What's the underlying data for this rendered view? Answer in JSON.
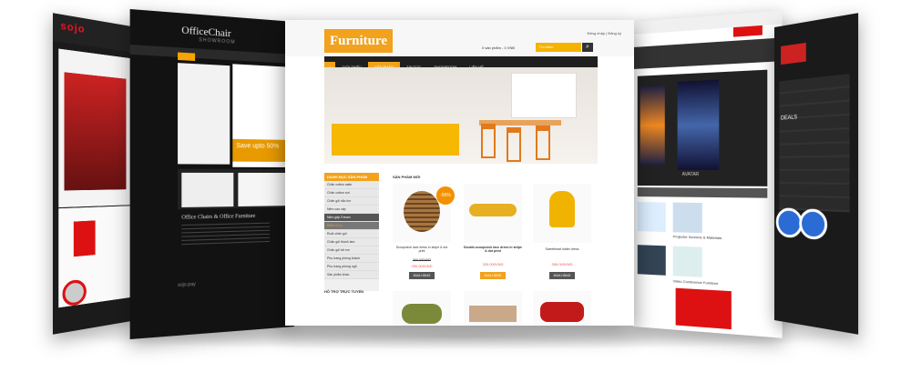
{
  "sojo": {
    "logo": "sojo"
  },
  "office_chair": {
    "logo": "OfficeChair",
    "subtitle": "SHOWROOM",
    "sale_text": "Save upto 50%",
    "section_title": "Office Chairs & Office Furniture",
    "footer_text": "sojo.pay"
  },
  "furniture": {
    "logo": "Furniture",
    "top_links": "Đăng nhập | Đăng ký",
    "cart": "0 sản phẩm - 0 VNĐ",
    "search_placeholder": "Tìm kiếm",
    "nav": [
      "GIỚI THIỆU",
      "SẢN PHẨM",
      "TIN TỨC",
      "SHOWROOM",
      "LIÊN HỆ"
    ],
    "sidebar": {
      "heading": "DANH MỤC SẢN PHẨM",
      "items": [
        "Chăn cotton satin",
        "Chăn cotton sợi",
        "Chăn gối sắc tím",
        "Nệm cao cấp",
        "Nệm gấp Dream",
        "Điếm lò xo",
        "Ruột chăn gối",
        "Chăn gối thanh lam",
        "Chăn gối trẻ em",
        "Phụ trang phòng khách",
        "Phụ trang phòng ngủ",
        "Sản phẩm khác"
      ]
    },
    "support_heading": "HỖ TRỢ TRỰC TUYẾN",
    "new_products_heading": "SẢN PHẨM MỚI",
    "sale_badge": "-50%",
    "products": [
      {
        "name": "Scoopneck lace dress in stripe & dot print",
        "old_price": "300.000VND",
        "price": "250.000VND",
        "button": "MUA HÀNG"
      },
      {
        "name": "Double-scoopneck lace dress in stripe & dot print",
        "old_price": "",
        "price": "325.000VND",
        "button": "MUA HÀNG"
      },
      {
        "name": "Sweetheart halter dress",
        "old_price": "",
        "price": "355.000VND",
        "button": "MUA HÀNG"
      }
    ]
  },
  "right_panel": {
    "label": "AVATAR",
    "item1": "Projector Screens & Materials",
    "item2": "Video Conference Furniture"
  },
  "far_right": {
    "deals": "DEALS"
  }
}
